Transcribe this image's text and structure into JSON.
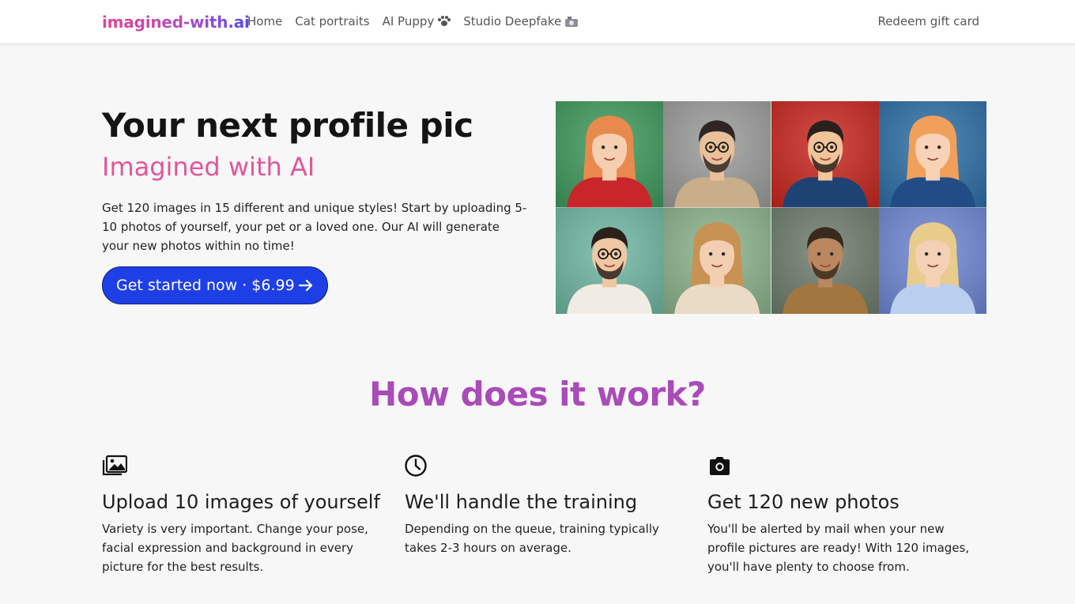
{
  "nav": {
    "brand": "imagined-with.ai",
    "links": [
      {
        "label": "Home"
      },
      {
        "label": "Cat portraits"
      },
      {
        "label": "AI Puppy",
        "icon": "paw-icon"
      },
      {
        "label": "Studio Deepfake",
        "icon": "video-camera-icon"
      }
    ],
    "redeem": "Redeem gift card"
  },
  "hero": {
    "title": "Your next profile pic",
    "subtitle": "Imagined with AI",
    "description": "Get 120 images in 15 different and unique styles! Start by uploading 5-10 photos of yourself, your pet or a loved one. Our AI will generate your new photos within no time!",
    "cta_label": "Get started now · $6.99",
    "cta_icon": "arrow-right-icon"
  },
  "gallery": {
    "portraits": [
      {
        "bg": "#3e9a5c",
        "skin": "#f5cfb0",
        "hair": "#e88a4e",
        "cloth": "#c8262a",
        "glasses": false
      },
      {
        "bg": "#9a9c9a",
        "skin": "#e9c09a",
        "hair": "#2e2622",
        "cloth": "#c9ae8a",
        "glasses": true
      },
      {
        "bg": "#c9261e",
        "skin": "#f2c49a",
        "hair": "#2a211c",
        "cloth": "#1e4272",
        "glasses": true
      },
      {
        "bg": "#2d6fa6",
        "skin": "#f7d2b6",
        "hair": "#f0a05a",
        "cloth": "#214c86",
        "glasses": false
      },
      {
        "bg": "#6fb7a3",
        "skin": "#efc7a2",
        "hair": "#2a201c",
        "cloth": "#f0ebe3",
        "glasses": true
      },
      {
        "bg": "#8bb48c",
        "skin": "#f3cfb1",
        "hair": "#c79254",
        "cloth": "#eadbc6",
        "glasses": false
      },
      {
        "bg": "#6e7c6e",
        "skin": "#b98860",
        "hair": "#3a2a1e",
        "cloth": "#a2773f",
        "glasses": false
      },
      {
        "bg": "#6f86d3",
        "skin": "#f4d0b6",
        "hair": "#e8cc8c",
        "cloth": "#b9cff0",
        "glasses": false
      }
    ]
  },
  "how": {
    "title": "How does it work?",
    "features": [
      {
        "icon": "images-icon",
        "title": "Upload 10 images of yourself",
        "description": "Variety is very important. Change your pose, facial expression and background in every picture for the best results."
      },
      {
        "icon": "clock-icon",
        "title": "We'll handle the training",
        "description": "Depending on the queue, training typically takes 2-3 hours on average."
      },
      {
        "icon": "camera-icon",
        "title": "Get 120 new photos",
        "description": "You'll be alerted by mail when your new profile pictures are ready! With 120 images, you'll have plenty to choose from."
      }
    ]
  },
  "colors": {
    "accent_pink": "#e0569b",
    "accent_purple": "#a94bb8",
    "cta_blue": "#1f3fe6"
  }
}
